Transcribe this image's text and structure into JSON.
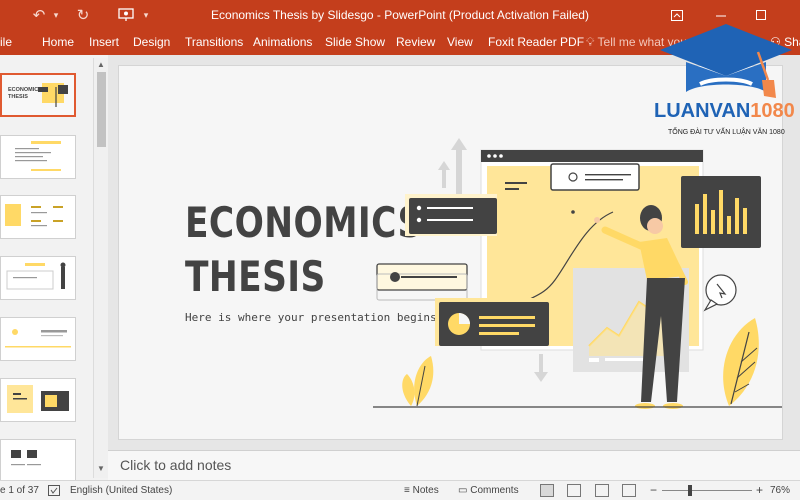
{
  "window": {
    "title": "Economics Thesis by Slidesgo - PowerPoint (Product Activation Failed)"
  },
  "quick_access": {
    "undo_icon": "undo-icon",
    "redo_icon": "redo-icon",
    "present_icon": "slideshow-icon",
    "customize_icon": "chevron-down-icon"
  },
  "ribbon": {
    "tabs": [
      "ile",
      "Home",
      "Insert",
      "Design",
      "Transitions",
      "Animations",
      "Slide Show",
      "Review",
      "View",
      "Foxit Reader PDF"
    ],
    "tell_me": "Tell me what you",
    "share": "Shar"
  },
  "slide": {
    "title": "ECONOMICS\nTHESIS",
    "subtitle": "Here is where your presentation begins"
  },
  "thumbnails": {
    "count": 7,
    "selected_index": 0
  },
  "notes": {
    "placeholder": "Click to add notes"
  },
  "status": {
    "slide_counter": "e 1 of 37",
    "language": "English (United States)",
    "notes_label": "Notes",
    "comments_label": "Comments",
    "zoom": "76%",
    "zoom_minus": "−",
    "zoom_plus": "+"
  },
  "watermark": {
    "brand": "LUANVAN1080",
    "tagline": "TỔNG ĐÀI TƯ VẤN LUẬN VĂN 1080"
  },
  "colors": {
    "ribbon": "#c43e1c",
    "accent_yellow": "#ffd966",
    "dark": "#434343",
    "logo_blue": "#1f63b5",
    "logo_orange": "#f2884b"
  }
}
